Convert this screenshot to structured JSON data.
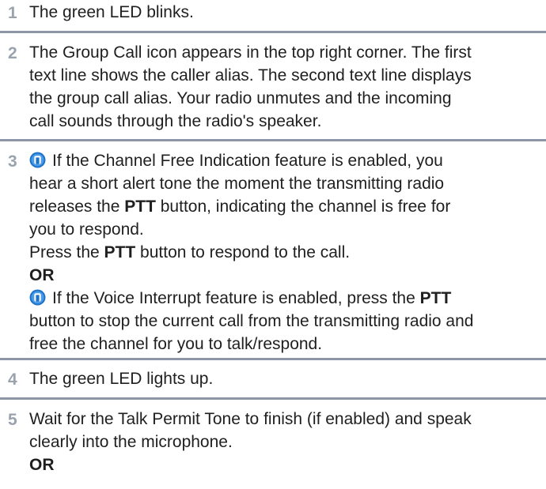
{
  "steps": [
    {
      "number": "1",
      "text": "The green LED blinks."
    },
    {
      "number": "2",
      "lines": [
        "The Group Call icon appears in the top right corner. The first",
        "text line shows the caller alias. The second text line displays",
        "the group call alias. Your radio unmutes and the incoming",
        "call sounds through the radio's speaker."
      ]
    },
    {
      "number": "3",
      "para1_line1_text": "If the Channel Free Indication feature is enabled, you",
      "para1_line2": "hear a short alert tone the moment the transmitting radio",
      "para1_line3_pre": "releases the ",
      "para1_line3_bold": "PTT",
      "para1_line3_post": " button, indicating the channel is free for",
      "para1_line4": "you to respond.",
      "press_pre": "Press the ",
      "press_bold": "PTT",
      "press_post": " button to respond to the call.",
      "or_label": "OR",
      "para2_line1_pre": "If the Voice Interrupt feature is enabled, press the ",
      "para2_line1_bold": "PTT",
      "para2_line2": "button to stop the current call from the transmitting radio and",
      "para2_line3": "free the channel for you to talk/respond.",
      "icon": "radio-feature-icon"
    },
    {
      "number": "4",
      "text": "The green LED lights up."
    },
    {
      "number": "5",
      "lines": [
        "Wait for the Talk Permit Tone to finish (if enabled) and speak",
        "clearly into the microphone."
      ],
      "or_label": "OR"
    }
  ],
  "colors": {
    "number": "#9aa3ad",
    "separator": "#8c96a6",
    "icon_blue": "#1e73c8"
  }
}
